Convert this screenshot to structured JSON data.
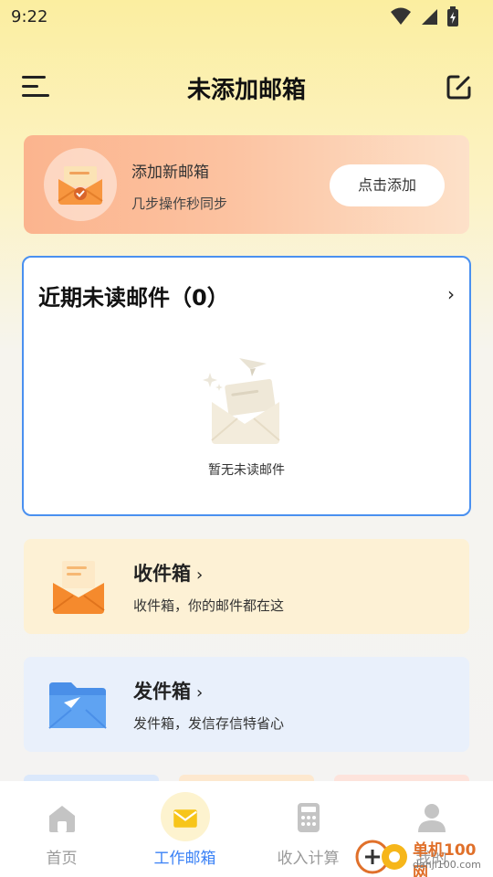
{
  "status_bar": {
    "time": "9:22"
  },
  "header": {
    "title": "未添加邮箱"
  },
  "add_card": {
    "title": "添加新邮箱",
    "subtitle": "几步操作秒同步",
    "button_label": "点击添加"
  },
  "unread": {
    "title": "近期未读邮件（0）",
    "empty_text": "暂无未读邮件",
    "count": 0
  },
  "inbox": {
    "title": "收件箱",
    "subtitle": "收件箱，你的邮件都在这"
  },
  "sent": {
    "title": "发件箱",
    "subtitle": "发件箱，发信存信特省心"
  },
  "tabs": [
    {
      "label": "首页",
      "icon": "home-icon"
    },
    {
      "label": "工作邮箱",
      "icon": "mail-icon",
      "active": true
    },
    {
      "label": "收入计算",
      "icon": "calculator-icon"
    },
    {
      "label": "我的",
      "icon": "profile-icon"
    }
  ],
  "watermark": {
    "line1": "单机100网",
    "line2": "danji100.com"
  },
  "colors": {
    "accent": "#3b82f6",
    "card_border": "#4a90f0",
    "inbox_bg": "#fdf1d5",
    "sent_bg": "#e9f0fb"
  }
}
